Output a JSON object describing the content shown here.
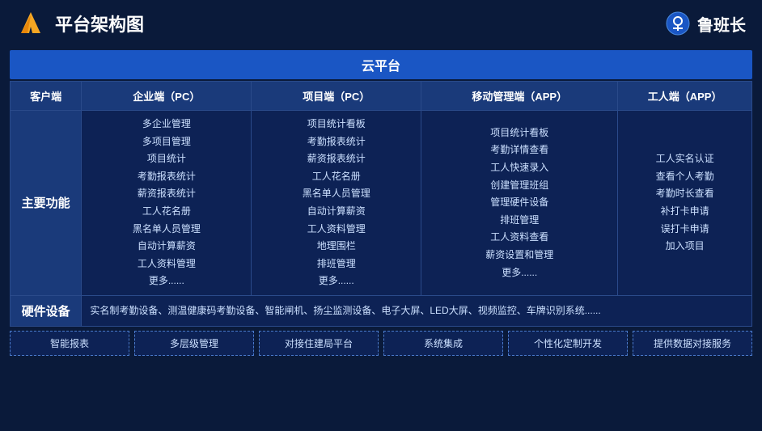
{
  "header": {
    "title": "平台架构图",
    "brand": "鲁班长"
  },
  "cloud": {
    "label": "云平台"
  },
  "columns": {
    "client": "客户端",
    "enterprise": "企业端（PC）",
    "project": "项目端（PC）",
    "mobile": "移动管理端（APP）",
    "worker": "工人端（APP）"
  },
  "rows": {
    "main_function_label": "主要功能",
    "hardware_label": "硬件设备"
  },
  "enterprise_features": "多企业管理\n多项目管理\n项目统计\n考勤报表统计\n薪资报表统计\n工人花名册\n黑名单人员管理\n自动计算薪资\n工人资料管理\n更多......",
  "project_features": "项目统计看板\n考勤报表统计\n薪资报表统计\n工人花名册\n黑名单人员管理\n自动计算薪资\n工人资料管理\n地理围栏\n排班管理\n更多......",
  "mobile_features": "项目统计看板\n考勤详情查看\n工人快速录入\n创建管理班组\n管理硬件设备\n排班管理\n工人资料查看\n薪资设置和管理\n更多......",
  "worker_features": "工人实名认证\n查看个人考勤\n考勤时长查看\n补打卡申请\n误打卡申请\n加入项目",
  "hardware_desc": "实名制考勤设备、测温健康码考勤设备、智能闸机、扬尘监测设备、电子大屏、LED大屏、视频监控、车牌识别系统......",
  "bottom_items": [
    "智能报表",
    "多层级管理",
    "对接住建局平台",
    "系统集成",
    "个性化定制开发",
    "提供数据对接服务"
  ]
}
